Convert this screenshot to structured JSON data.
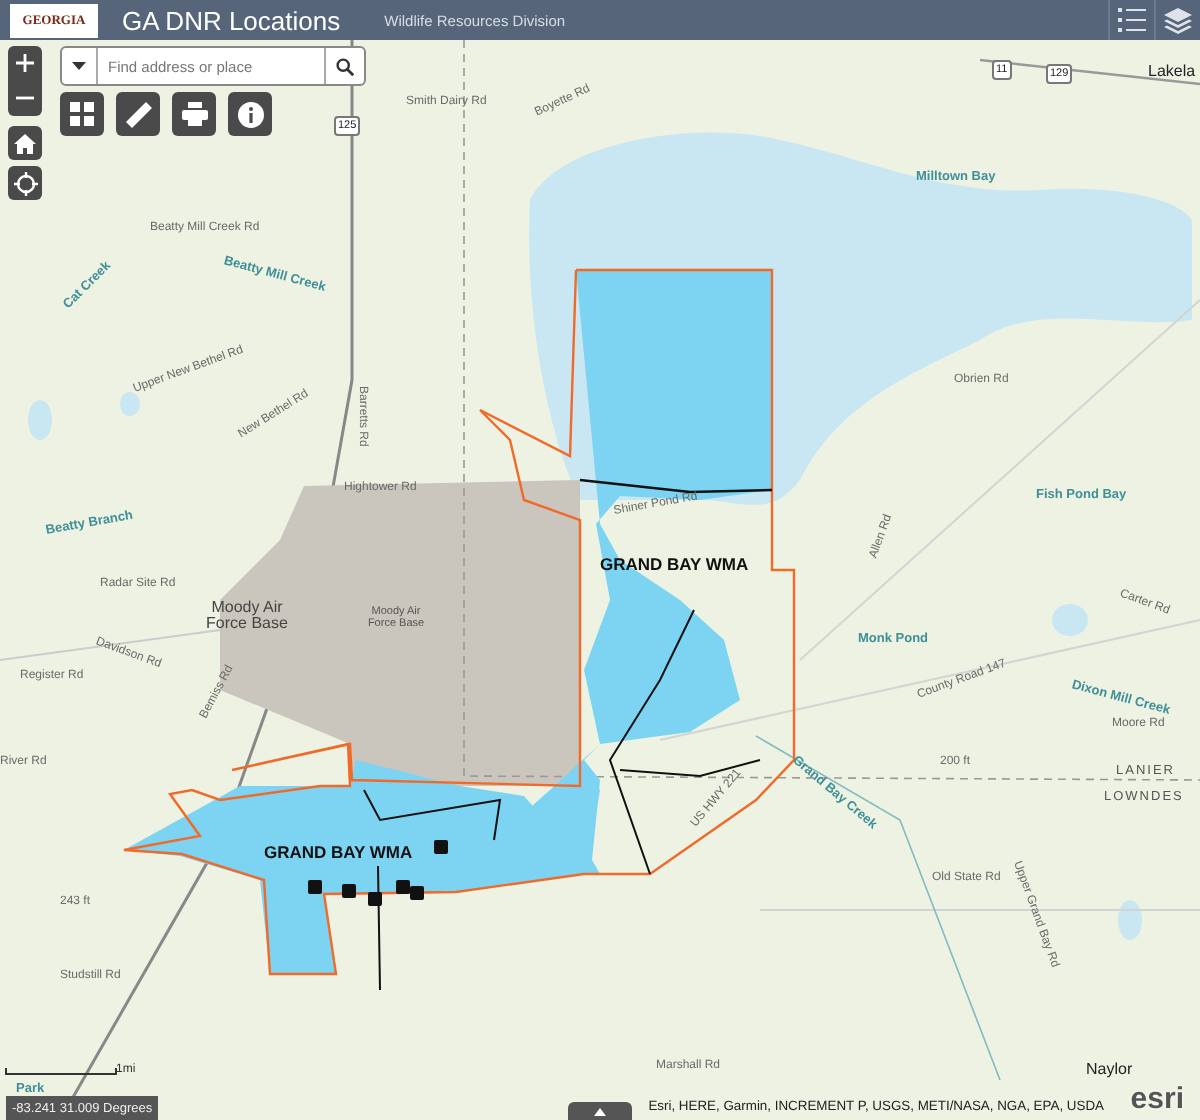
{
  "header": {
    "logo_text": "GEORGIA",
    "title": "GA DNR Locations",
    "subtitle": "Wildlife Resources Division"
  },
  "search": {
    "placeholder": "Find address or place"
  },
  "map_labels": [
    {
      "text": "Smith Dairy Rd",
      "kind": "road"
    },
    {
      "text": "Boyette Rd",
      "kind": "road"
    },
    {
      "text": "Beatty Mill Creek Rd",
      "kind": "road"
    },
    {
      "text": "Beatty Mill Creek",
      "kind": "water"
    },
    {
      "text": "Cat Creek",
      "kind": "water"
    },
    {
      "text": "Upper New Bethel Rd",
      "kind": "road"
    },
    {
      "text": "New Bethel Rd",
      "kind": "road"
    },
    {
      "text": "Barretts Rd",
      "kind": "road"
    },
    {
      "text": "Hightower Rd",
      "kind": "road"
    },
    {
      "text": "Beatty Branch",
      "kind": "water"
    },
    {
      "text": "Radar Site Rd",
      "kind": "road"
    },
    {
      "text": "Moody Air Force Base",
      "kind": "area"
    },
    {
      "text": "Moody Air Force Base",
      "kind": "small_area"
    },
    {
      "text": "Davidson Rd",
      "kind": "road"
    },
    {
      "text": "Bemiss Rd",
      "kind": "road"
    },
    {
      "text": "Register Rd",
      "kind": "road"
    },
    {
      "text": "River Rd",
      "kind": "road"
    },
    {
      "text": "GRAND BAY WMA",
      "kind": "wma"
    },
    {
      "text": "Shiner Pond Rd",
      "kind": "road"
    },
    {
      "text": "GRAND BAY WMA",
      "kind": "wma"
    },
    {
      "text": "Obrien Rd",
      "kind": "road"
    },
    {
      "text": "Allen Rd",
      "kind": "road"
    },
    {
      "text": "Fish Pond Bay",
      "kind": "water"
    },
    {
      "text": "Milltown Bay",
      "kind": "water"
    },
    {
      "text": "Monk Pond",
      "kind": "water"
    },
    {
      "text": "County Road 147",
      "kind": "road"
    },
    {
      "text": "Dixon Mill Creek",
      "kind": "water"
    },
    {
      "text": "Moore Rd",
      "kind": "road"
    },
    {
      "text": "Grand Bay Creek",
      "kind": "water"
    },
    {
      "text": "US HWY 221",
      "kind": "road"
    },
    {
      "text": "200 ft",
      "kind": "road"
    },
    {
      "text": "LANIER",
      "kind": "county"
    },
    {
      "text": "LOWNDES",
      "kind": "county"
    },
    {
      "text": "Old State Rd",
      "kind": "road"
    },
    {
      "text": "Upper Grand Bay Rd",
      "kind": "road"
    },
    {
      "text": "Studstill Rd",
      "kind": "road"
    },
    {
      "text": "Marshall Rd",
      "kind": "road"
    },
    {
      "text": "Naylor",
      "kind": "place"
    },
    {
      "text": "Lakela",
      "kind": "place"
    },
    {
      "text": "Carter Rd",
      "kind": "road"
    },
    {
      "text": "243 ft",
      "kind": "road"
    },
    {
      "text": "125",
      "kind": "shield"
    },
    {
      "text": "11",
      "kind": "shield"
    },
    {
      "text": "129",
      "kind": "shield"
    },
    {
      "text": "Park",
      "kind": "water"
    }
  ],
  "scale_bar": {
    "label": "1mi"
  },
  "coordinates": "-83.241 31.009 Degrees",
  "attribution": "Esri, HERE, Garmin, INCREMENT P, USGS, METI/NASA, NGA, EPA, USDA",
  "esri_logo": "esri"
}
